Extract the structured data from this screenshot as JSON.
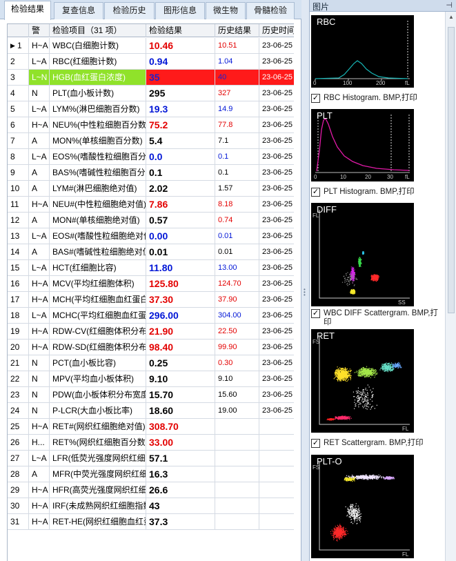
{
  "tabs": [
    "检验结果",
    "复查信息",
    "检验历史",
    "图形信息",
    "微生物",
    "骨髓检验"
  ],
  "columns": {
    "flag": "警",
    "name": "检验项目（31 项）",
    "result": "检验结果",
    "history": "历史结果",
    "history_time": "历史时间"
  },
  "rows": [
    {
      "idx": "1",
      "flag": "H~A",
      "name": "WBC(白细胞计数)",
      "result": "10.46",
      "color": "red",
      "history": "10.51",
      "hcolor": "red",
      "htime": "23-06-25"
    },
    {
      "idx": "2",
      "flag": "L~A",
      "name": "RBC(红细胞计数)",
      "result": "0.94",
      "color": "blue",
      "history": "1.04",
      "hcolor": "blue",
      "htime": "23-06-25"
    },
    {
      "idx": "3",
      "flag": "L~N",
      "name": "HGB(血红蛋白浓度)",
      "result": "35",
      "color": "blue",
      "history": "40",
      "hcolor": "blue",
      "htime": "23-06-25",
      "highlight": true
    },
    {
      "idx": "4",
      "flag": "N",
      "name": "PLT(血小板计数)",
      "result": "295",
      "color": "black",
      "history": "327",
      "hcolor": "red",
      "htime": "23-06-25"
    },
    {
      "idx": "5",
      "flag": "L~A",
      "name": "LYM%(淋巴细胞百分数)",
      "result": "19.3",
      "color": "blue",
      "history": "14.9",
      "hcolor": "blue",
      "htime": "23-06-25"
    },
    {
      "idx": "6",
      "flag": "H~A",
      "name": "NEU%(中性粒细胞百分数)",
      "result": "75.2",
      "color": "red",
      "history": "77.8",
      "hcolor": "red",
      "htime": "23-06-25"
    },
    {
      "idx": "7",
      "flag": "A",
      "name": "MON%(单核细胞百分数)",
      "result": "5.4",
      "color": "black",
      "history": "7.1",
      "hcolor": "black",
      "htime": "23-06-25"
    },
    {
      "idx": "8",
      "flag": "L~A",
      "name": "EOS%(嗜酸性粒细胞百分数)",
      "result": "0.0",
      "color": "blue",
      "history": "0.1",
      "hcolor": "blue",
      "htime": "23-06-25"
    },
    {
      "idx": "9",
      "flag": "A",
      "name": "BAS%(嗜碱性粒细胞百分数)",
      "result": "0.1",
      "color": "black",
      "history": "0.1",
      "hcolor": "black",
      "htime": "23-06-25"
    },
    {
      "idx": "10",
      "flag": "A",
      "name": "LYM#(淋巴细胞绝对值)",
      "result": "2.02",
      "color": "black",
      "history": "1.57",
      "hcolor": "black",
      "htime": "23-06-25"
    },
    {
      "idx": "11",
      "flag": "H~A",
      "name": "NEU#(中性粒细胞绝对值)",
      "result": "7.86",
      "color": "red",
      "history": "8.18",
      "hcolor": "red",
      "htime": "23-06-25"
    },
    {
      "idx": "12",
      "flag": "A",
      "name": "MON#(单核细胞绝对值)",
      "result": "0.57",
      "color": "black",
      "history": "0.74",
      "hcolor": "red",
      "htime": "23-06-25"
    },
    {
      "idx": "13",
      "flag": "L~A",
      "name": "EOS#(嗜酸性粒细胞绝对值)",
      "result": "0.00",
      "color": "blue",
      "history": "0.01",
      "hcolor": "blue",
      "htime": "23-06-25"
    },
    {
      "idx": "14",
      "flag": "A",
      "name": "BAS#(嗜碱性粒细胞绝对值)",
      "result": "0.01",
      "color": "black",
      "history": "0.01",
      "hcolor": "black",
      "htime": "23-06-25"
    },
    {
      "idx": "15",
      "flag": "L~A",
      "name": "HCT(红细胞比容)",
      "result": "11.80",
      "color": "blue",
      "history": "13.00",
      "hcolor": "blue",
      "htime": "23-06-25"
    },
    {
      "idx": "16",
      "flag": "H~A",
      "name": "MCV(平均红细胞体积)",
      "result": "125.80",
      "color": "red",
      "history": "124.70",
      "hcolor": "red",
      "htime": "23-06-25"
    },
    {
      "idx": "17",
      "flag": "H~A",
      "name": "MCH(平均红细胞血红蛋白含量)",
      "result": "37.30",
      "color": "red",
      "history": "37.90",
      "hcolor": "red",
      "htime": "23-06-25"
    },
    {
      "idx": "18",
      "flag": "L~A",
      "name": "MCHC(平均红细胞血红蛋白浓度)",
      "result": "296.00",
      "color": "blue",
      "history": "304.00",
      "hcolor": "blue",
      "htime": "23-06-25"
    },
    {
      "idx": "19",
      "flag": "H~A",
      "name": "RDW-CV(红细胞体积分布宽度)",
      "result": "21.90",
      "color": "red",
      "history": "22.50",
      "hcolor": "red",
      "htime": "23-06-25"
    },
    {
      "idx": "20",
      "flag": "H~A",
      "name": "RDW-SD(红细胞体积分布宽度)",
      "result": "98.40",
      "color": "red",
      "history": "99.90",
      "hcolor": "red",
      "htime": "23-06-25"
    },
    {
      "idx": "21",
      "flag": "N",
      "name": "PCT(血小板比容)",
      "result": "0.25",
      "color": "black",
      "history": "0.30",
      "hcolor": "red",
      "htime": "23-06-25"
    },
    {
      "idx": "22",
      "flag": "N",
      "name": "MPV(平均血小板体积)",
      "result": "9.10",
      "color": "black",
      "history": "9.10",
      "hcolor": "black",
      "htime": "23-06-25"
    },
    {
      "idx": "23",
      "flag": "N",
      "name": "PDW(血小板体积分布宽度)",
      "result": "15.70",
      "color": "black",
      "history": "15.60",
      "hcolor": "black",
      "htime": "23-06-25"
    },
    {
      "idx": "24",
      "flag": "N",
      "name": "P-LCR(大血小板比率)",
      "result": "18.60",
      "color": "black",
      "history": "19.00",
      "hcolor": "black",
      "htime": "23-06-25"
    },
    {
      "idx": "25",
      "flag": "H~A",
      "name": "RET#(网织红细胞绝对值)",
      "result": "308.70",
      "color": "red",
      "history": "",
      "hcolor": "black",
      "htime": ""
    },
    {
      "idx": "26",
      "flag": "H...",
      "name": "RET%(网织红细胞百分数)",
      "result": "33.00",
      "color": "red",
      "history": "",
      "hcolor": "black",
      "htime": ""
    },
    {
      "idx": "27",
      "flag": "L~A",
      "name": "LFR(低荧光强度网织红细胞)",
      "result": "57.1",
      "color": "black",
      "history": "",
      "hcolor": "black",
      "htime": ""
    },
    {
      "idx": "28",
      "flag": "A",
      "name": "MFR(中荧光强度网织红细胞)",
      "result": "16.3",
      "color": "black",
      "history": "",
      "hcolor": "black",
      "htime": ""
    },
    {
      "idx": "29",
      "flag": "H~A",
      "name": "HFR(高荧光强度网织红细胞)",
      "result": "26.6",
      "color": "black",
      "history": "",
      "hcolor": "black",
      "htime": ""
    },
    {
      "idx": "30",
      "flag": "H~A",
      "name": "IRF(未成熟网织红细胞指数)",
      "result": "43",
      "color": "black",
      "history": "",
      "hcolor": "black",
      "htime": ""
    },
    {
      "idx": "31",
      "flag": "H~A",
      "name": "RET-HE(网织红细胞血红蛋白)",
      "result": "37.3",
      "color": "black",
      "history": "",
      "hcolor": "black",
      "htime": ""
    }
  ],
  "right_panel": {
    "title": "图片",
    "images": [
      {
        "plot_title": "RBC",
        "caption": "RBC Histogram. BMP,打印",
        "checked": true,
        "ticks": [
          "0",
          "100",
          "200",
          "fL"
        ]
      },
      {
        "plot_title": "PLT",
        "caption": "PLT Histogram. BMP,打印",
        "checked": true,
        "ticks": [
          "0",
          "10",
          "20",
          "30",
          "fL"
        ]
      },
      {
        "plot_title": "DIFF",
        "caption": "WBC DIFF Scattergram. BMP,打印",
        "checked": true,
        "axis_y": "FL",
        "axis_x": "SS"
      },
      {
        "plot_title": "RET",
        "caption": "RET Scattergram. BMP,打印",
        "checked": true,
        "axis_y": "FS",
        "axis_x": "FL"
      },
      {
        "plot_title": "PLT-O",
        "caption": "",
        "checked": false,
        "axis_y": "FS",
        "axis_x": "FL"
      }
    ]
  }
}
